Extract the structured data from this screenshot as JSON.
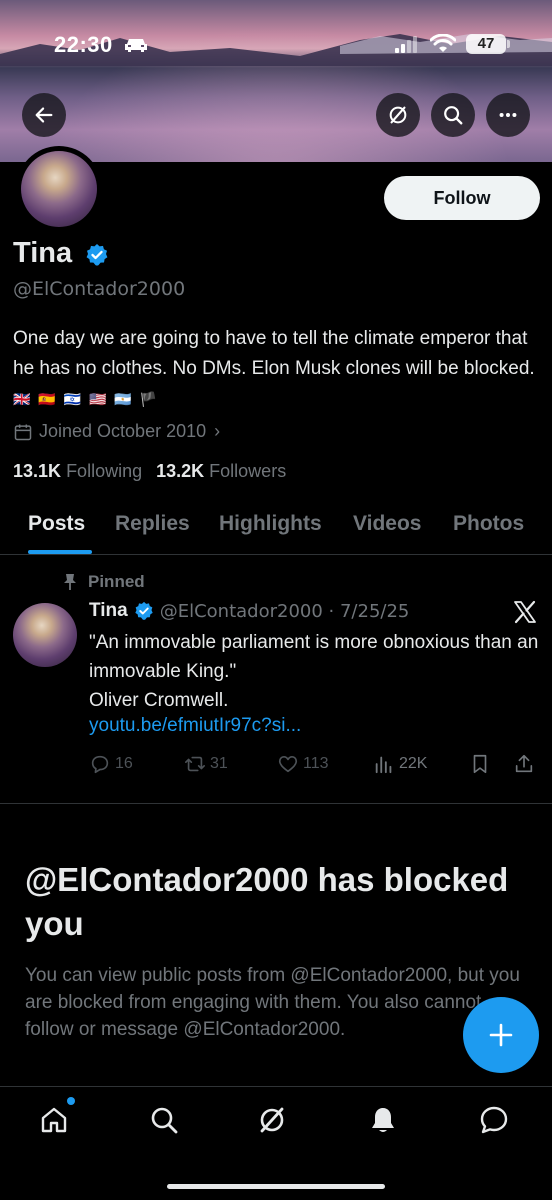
{
  "status_bar": {
    "time": "22:30",
    "battery": "47"
  },
  "profile": {
    "follow_label": "Follow",
    "name": "Tina",
    "handle": "@ElContador2000",
    "bio": "One day we are going to have to tell the climate emperor that he has no clothes. No DMs. Elon Musk clones will be blocked.",
    "bio_flags": "🇬🇧 🇪🇸 🇮🇱 🇺🇸 🇦🇷 🏴",
    "joined": "Joined October 2010",
    "following_count": "13.1K",
    "following_label": "Following",
    "followers_count": "13.2K",
    "followers_label": "Followers"
  },
  "tabs": [
    {
      "label": "Posts",
      "active": true
    },
    {
      "label": "Replies"
    },
    {
      "label": "Highlights"
    },
    {
      "label": "Videos"
    },
    {
      "label": "Photos"
    }
  ],
  "pinned_post": {
    "pinned_label": "Pinned",
    "author": "Tina",
    "handle_date": "@ElContador2000 · 7/25/25",
    "text_line1": "\"An immovable parliament is more obnoxious than an immovable King.\"",
    "text_line2": "Oliver Cromwell.",
    "link": "youtu.be/efmiutIr97c?si...",
    "replies": "16",
    "reposts": "31",
    "likes": "113",
    "views": "22K"
  },
  "blocked": {
    "title": "@ElContador2000 has blocked you",
    "description": "You can view public posts from @ElContador2000, but you are blocked from engaging with them. You also cannot follow or message @ElContador2000."
  },
  "colors": {
    "accent": "#1d9bf0",
    "background": "#000000",
    "muted_text": "#71767b"
  },
  "icons": [
    "back-arrow-icon",
    "grok-icon",
    "search-icon",
    "more-icon",
    "verified-badge-icon",
    "calendar-icon",
    "pin-icon",
    "x-logo-icon",
    "reply-icon",
    "repost-icon",
    "like-icon",
    "views-icon",
    "bookmark-icon",
    "share-icon",
    "plus-icon",
    "home-icon",
    "notifications-icon",
    "messages-icon"
  ]
}
